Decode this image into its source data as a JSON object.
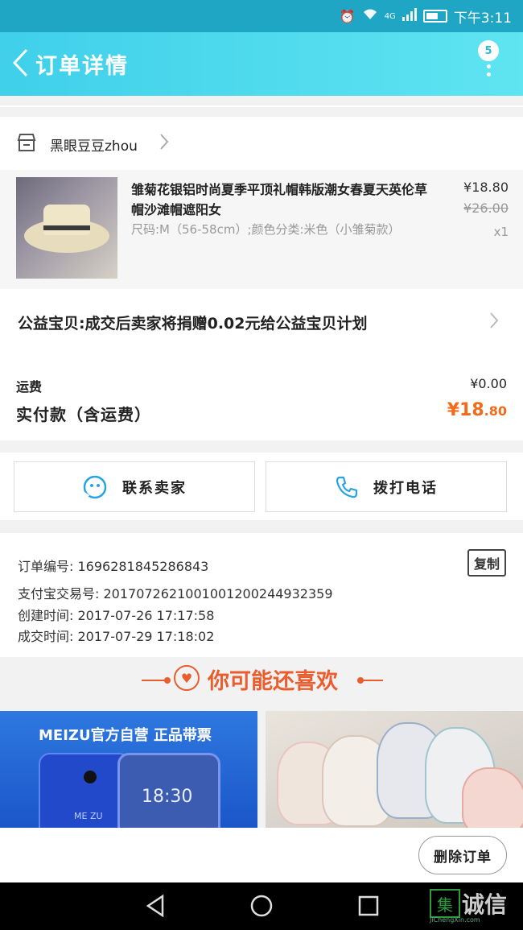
{
  "status_bar": {
    "network": "4G",
    "time": "下午3:11"
  },
  "header": {
    "title": "订单详情",
    "badge_count": "5"
  },
  "shop": {
    "name": "黑眼豆豆zhou"
  },
  "item": {
    "title": "雏菊花银铝时尚夏季平顶礼帽韩版潮女春夏天英伦草帽沙滩帽遮阳女",
    "spec": "尺码:M（56-58cm）;颜色分类:米色（小雏菊款）",
    "price": "¥18.80",
    "original_price": "¥26.00",
    "quantity": "x1"
  },
  "charity": {
    "text": "公益宝贝:成交后卖家将捐赠0.02元给公益宝贝计划"
  },
  "totals": {
    "shipping_label": "运费",
    "shipping_value": "¥0.00",
    "paid_label": "实付款（含运费）",
    "paid_currency": "¥",
    "paid_main": "18",
    "paid_cents": ".80"
  },
  "actions": {
    "contact_seller": "联系卖家",
    "call_phone": "拨打电话"
  },
  "order_info": {
    "order_no": "订单编号: 1696281845286843",
    "alipay_no": "支付宝交易号: 2017072621001001200244932359",
    "created": "创建时间: 2017-07-26 17:17:58",
    "completed": "成交时间: 2017-07-29 17:18:02",
    "copy_label": "复制"
  },
  "recommend": {
    "heading": "你可能还喜欢",
    "cards": [
      {
        "banner": "MEIZU官方自营 正品带票",
        "clock": "18:30",
        "brand": "ME ZU"
      },
      {}
    ]
  },
  "footer": {
    "delete_order": "删除订单"
  },
  "watermark": {
    "mark": "集",
    "text": "诚信",
    "sub": "JiChengXin.com"
  },
  "colors": {
    "accent": "#3fd0ea",
    "price_highlight": "#f26a1b",
    "recommend_accent": "#ea5d2e"
  }
}
